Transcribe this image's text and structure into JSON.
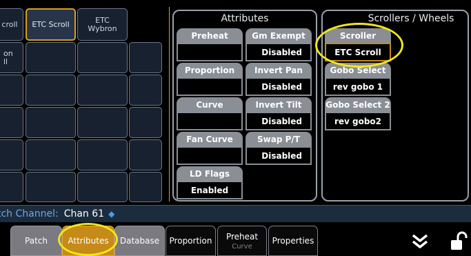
{
  "grid": {
    "row0": [
      "croll",
      "ETC Scroll",
      "ETC\nWybron"
    ],
    "row1_first": "on\nll"
  },
  "attributes_panel": {
    "title": "Attributes",
    "buttons": [
      {
        "label": "Preheat",
        "value": ""
      },
      {
        "label": "Gm Exempt",
        "value": "Disabled"
      },
      {
        "label": "Proportion",
        "value": ""
      },
      {
        "label": "Invert Pan",
        "value": "Disabled"
      },
      {
        "label": "Curve",
        "value": ""
      },
      {
        "label": "Invert Tilt",
        "value": "Disabled"
      },
      {
        "label": "Fan Curve",
        "value": ""
      },
      {
        "label": "Swap P/T",
        "value": "Disabled"
      },
      {
        "label": "LD Flags",
        "value": "Enabled"
      }
    ]
  },
  "scrollers_panel": {
    "title": "Scrollers / Wheels",
    "buttons": [
      {
        "label": "Scroller",
        "value": "ETC Scroll"
      },
      {
        "label": "Gobo Select",
        "value": "rev gobo 1"
      },
      {
        "label": "Gobo Select 2",
        "value": "rev gobo2"
      }
    ]
  },
  "channel_bar": {
    "label": "tch Channel:",
    "value": "Chan 61"
  },
  "tabs": [
    {
      "label": "Patch",
      "sub": ""
    },
    {
      "label": "Attributes",
      "sub": ""
    },
    {
      "label": "Database",
      "sub": ""
    },
    {
      "label": "Proportion",
      "sub": ""
    },
    {
      "label": "Preheat",
      "sub": "Curve"
    },
    {
      "label": "Properties",
      "sub": ""
    }
  ],
  "icons": [
    "diamond-icon",
    "double-chevron-down-icon",
    "unlock-icon"
  ],
  "colors": {
    "accent": "#c58a17",
    "highlight": "#f2e61d",
    "channel_text": "#6fa8e0"
  }
}
